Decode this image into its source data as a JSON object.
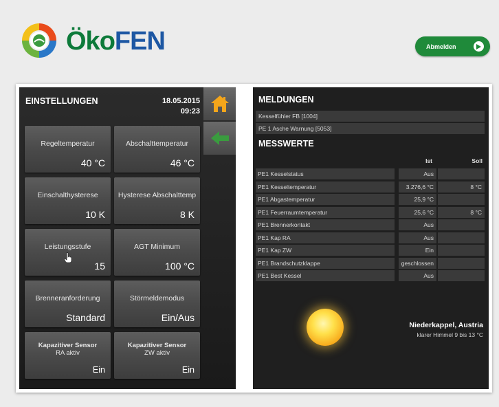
{
  "header": {
    "logo_text_oko": "Öko",
    "logo_text_fen": "FEN",
    "logout_label": "Abmelden"
  },
  "settings": {
    "title": "EINSTELLUNGEN",
    "date": "18.05.2015",
    "time": "09:23",
    "tiles": [
      {
        "label": "Regeltemperatur",
        "value": "40 °C"
      },
      {
        "label": "Abschalttemperatur",
        "value": "46 °C"
      },
      {
        "label": "Einschalthysterese",
        "value": "10 K"
      },
      {
        "label": "Hysterese Abschalttemp",
        "value": "8 K"
      },
      {
        "label": "Leistungsstufe",
        "value": "15"
      },
      {
        "label": "AGT Minimum",
        "value": "100 °C"
      },
      {
        "label": "Brenneranforderung",
        "value": "Standard"
      },
      {
        "label": "Störmeldemodus",
        "value": "Ein/Aus"
      },
      {
        "label_bold": "Kapazitiver Sensor",
        "label_sub": "RA aktiv",
        "value": "Ein"
      },
      {
        "label_bold": "Kapazitiver Sensor",
        "label_sub": "ZW aktiv",
        "value": "Ein"
      }
    ],
    "side_buttons": [
      {
        "icon": "home-icon",
        "color": "#f3a51b"
      },
      {
        "icon": "back-arrow-icon",
        "color": "#3a9b3f"
      }
    ]
  },
  "messages": {
    "title": "MELDUNGEN",
    "items": [
      "Kesselfühler FB [1004]",
      "PE 1 Asche Warnung [5053]"
    ]
  },
  "measurements": {
    "title": "MESSWERTE",
    "col_ist": "Ist",
    "col_soll": "Soll",
    "rows": [
      {
        "name": "PE1 Kesselstatus",
        "ist": "Aus",
        "soll": ""
      },
      {
        "name": "PE1 Kesseltemperatur",
        "ist": "3.276,6 °C",
        "soll": "8 °C"
      },
      {
        "name": "PE1 Abgastemperatur",
        "ist": "25,9 °C",
        "soll": ""
      },
      {
        "name": "PE1 Feuerraumtemperatur",
        "ist": "25,6 °C",
        "soll": "8 °C"
      },
      {
        "name": "PE1 Brennerkontakt",
        "ist": "Aus",
        "soll": ""
      },
      {
        "name": "PE1 Kap RA",
        "ist": "Aus",
        "soll": ""
      },
      {
        "name": "PE1 Kap ZW",
        "ist": "Ein",
        "soll": ""
      },
      {
        "name": "PE1 Brandschutzklappe",
        "ist": "geschlossen",
        "soll": ""
      },
      {
        "name": "PE1 Best Kessel",
        "ist": "Aus",
        "soll": ""
      }
    ]
  },
  "weather": {
    "location": "Niederkappel, Austria",
    "description": "klarer Himmel 9 bis 13 °C",
    "icon": "sun-icon"
  },
  "colors": {
    "brand_green": "#1f8a3a",
    "brand_blue": "#1d57a3",
    "panel_dark": "#1f1f1f"
  }
}
